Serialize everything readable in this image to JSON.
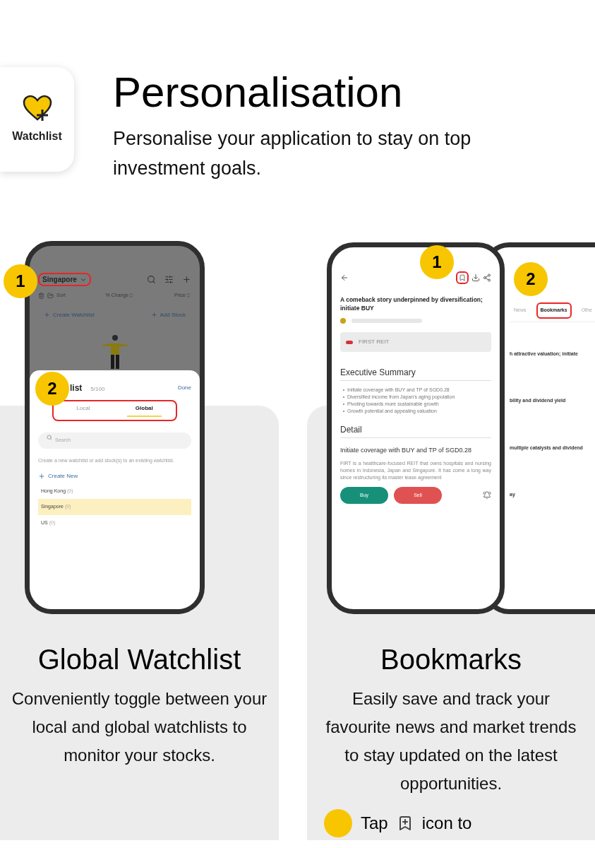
{
  "app_icon": {
    "label": "Watchlist"
  },
  "header": {
    "title": "Personalisation",
    "subtitle_lines": [
      "Personalise your application to stay on top",
      "investment goals."
    ]
  },
  "features": [
    {
      "kind": "watchlist",
      "title": "Global Watchlist",
      "description": "Conveniently toggle between your local and global watchlists to monitor your stocks.",
      "badges": [
        "1",
        "2"
      ],
      "phone": {
        "market": "Singapore",
        "columns": [
          "Sort",
          "% Change",
          "Price"
        ],
        "actions": [
          "Create Watchlist",
          "Add Stock"
        ],
        "sheet": {
          "title": "list",
          "count": "5/100",
          "done": "Done",
          "tabs": [
            {
              "label": "Local",
              "selected": false
            },
            {
              "label": "Global",
              "selected": true
            }
          ],
          "search_placeholder": "Search",
          "hint": "Create a new watchlist or add stock(s) to an existing watchlist.",
          "create": "Create New",
          "lists": [
            {
              "name": "Hong Kong",
              "count": "(0)",
              "selected": false
            },
            {
              "name": "Singapore",
              "count": "(0)",
              "selected": true
            },
            {
              "name": "US",
              "count": "(0)",
              "selected": false
            }
          ]
        }
      }
    },
    {
      "kind": "bookmarks",
      "title": "Bookmarks",
      "description": "Easily save and track your favourite news and market trends to stay updated on the latest opportunities.",
      "badges": [
        "1",
        "2"
      ],
      "phone": {
        "article_title": "A comeback story underpinned by diversification; initiate BUY",
        "stock": "FIRST REIT",
        "section_1": "Executive Summary",
        "bullets": [
          "Initiate coverage with BUY and TP of SGD0.28",
          "Diversified income from Japan's aging population",
          "Pivoting towards more sustainable growth",
          "Growth potential and appealing valuation"
        ],
        "section_2": "Detail",
        "subheading": "Initiate coverage with BUY and TP of SGD0.28",
        "body": "FIRT is a healthcare-focused REIT that owns hospitals and nursing homes in Indonesia, Japan and Singapore. It has come a long way since restructuring its master lease agreement",
        "buttons": [
          "Buy",
          "Sell"
        ],
        "back_tabs": [
          {
            "label": "News",
            "selected": false
          },
          {
            "label": "Bookmarks",
            "selected": true
          },
          {
            "label": "Othe",
            "selected": false
          }
        ],
        "bookmarks": [
          "h attractive valuation; initiate",
          "bility and dividend yield",
          "multiple catalysts and dividend",
          "ay"
        ]
      },
      "step": {
        "before": "Tap",
        "after": "icon to"
      }
    }
  ]
}
